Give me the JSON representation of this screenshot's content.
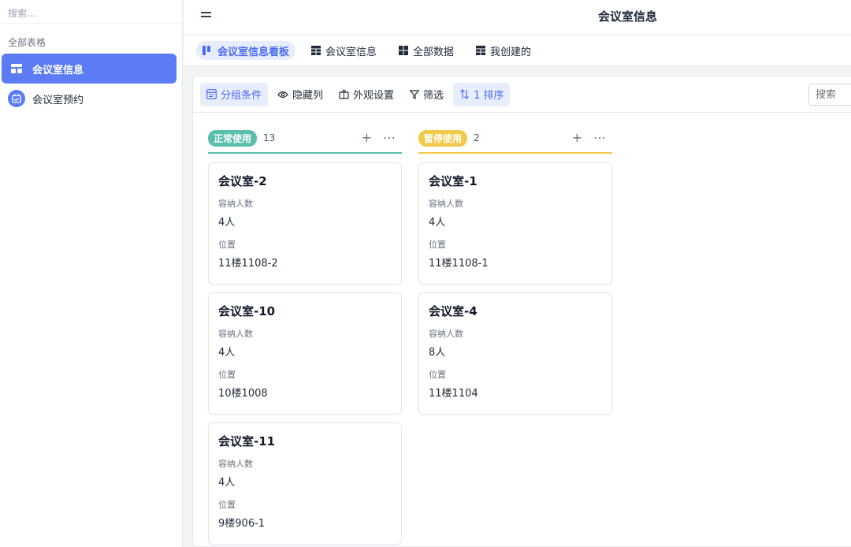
{
  "sidebar": {
    "search_placeholder": "搜索...",
    "section_label": "全部表格",
    "items": [
      {
        "label": "会议室信息",
        "icon": "table-icon",
        "active": true
      },
      {
        "label": "会议室预约",
        "icon": "calendar-check-icon",
        "active": false
      }
    ]
  },
  "header": {
    "title": "会议室信息",
    "menu_icon": "hamburger-menu-icon"
  },
  "tabs": [
    {
      "label": "会议室信息看板",
      "icon": "kanban-icon",
      "active": true
    },
    {
      "label": "会议室信息",
      "icon": "grid-table-icon",
      "active": false
    },
    {
      "label": "全部数据",
      "icon": "grid-table-icon",
      "active": false
    },
    {
      "label": "我创建的",
      "icon": "grid-table-icon",
      "active": false
    }
  ],
  "toolbar": {
    "group": "分组条件",
    "hide_columns": "隐藏列",
    "appearance": "外观设置",
    "filter": "筛选",
    "sort": "1 排序",
    "search_placeholder": "搜索"
  },
  "columns": [
    {
      "status": "正常使用",
      "count": "13",
      "color": "#5bbfae",
      "cards": [
        {
          "title": "会议室-2",
          "capacity_label": "容纳人数",
          "capacity": "4人",
          "location_label": "位置",
          "location": "11楼1108-2"
        },
        {
          "title": "会议室-10",
          "capacity_label": "容纳人数",
          "capacity": "4人",
          "location_label": "位置",
          "location": "10楼1008"
        },
        {
          "title": "会议室-11",
          "capacity_label": "容纳人数",
          "capacity": "4人",
          "location_label": "位置",
          "location": "9楼906-1"
        }
      ]
    },
    {
      "status": "暂停使用",
      "count": "2",
      "color": "#f3c94a",
      "cards": [
        {
          "title": "会议室-1",
          "capacity_label": "容纳人数",
          "capacity": "4人",
          "location_label": "位置",
          "location": "11楼1108-1"
        },
        {
          "title": "会议室-4",
          "capacity_label": "容纳人数",
          "capacity": "8人",
          "location_label": "位置",
          "location": "11楼1104"
        }
      ]
    }
  ],
  "colors": {
    "accent": "#5b7cf5",
    "accent_text": "#4a6cf0",
    "accent_bg": "#e8edfd"
  }
}
